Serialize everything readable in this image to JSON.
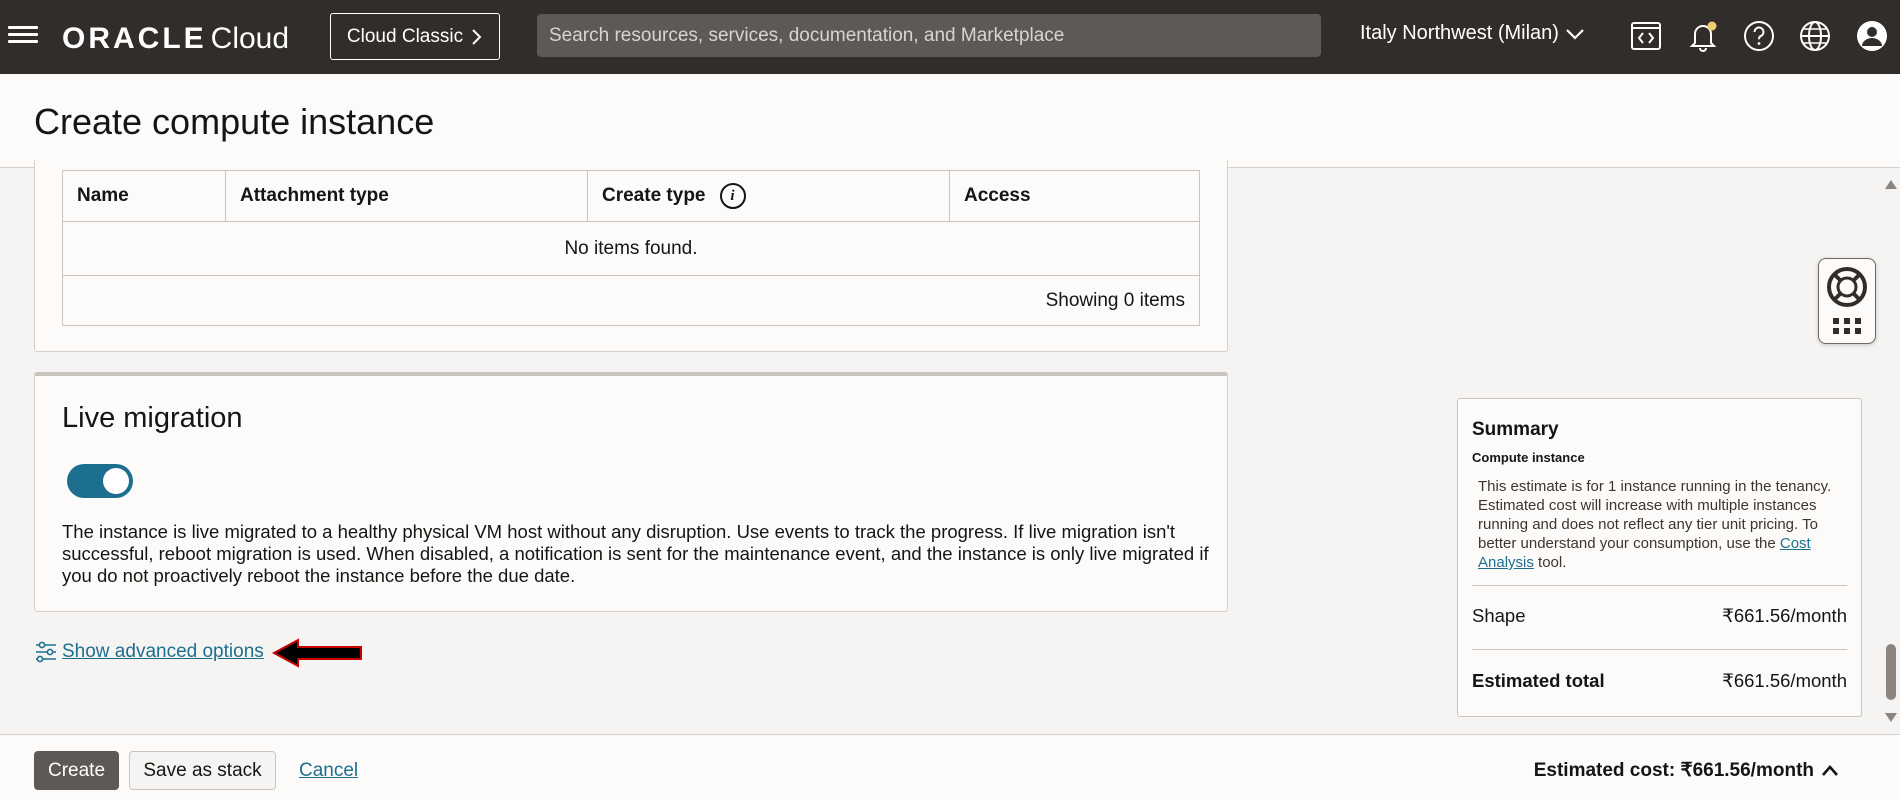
{
  "topbar": {
    "logo_brand": "ORACLE",
    "logo_product": "Cloud",
    "classic_button": "Cloud Classic",
    "search_placeholder": "Search resources, services, documentation, and Marketplace",
    "region": "Italy Northwest (Milan)"
  },
  "page": {
    "title": "Create compute instance"
  },
  "attachments_table": {
    "columns": [
      "Name",
      "Attachment type",
      "Create type",
      "Access"
    ],
    "empty_text": "No items found.",
    "footer_text": "Showing 0 items"
  },
  "live_migration": {
    "title": "Live migration",
    "enabled": true,
    "description": "The instance is live migrated to a healthy physical VM host without any disruption. Use events to track the progress. If live migration isn't successful, reboot migration is used. When disabled, a notification is sent for the maintenance event, and the instance is only live migrated if you do not proactively reboot the instance before the due date."
  },
  "advanced_link": "Show advanced options",
  "summary": {
    "title": "Summary",
    "subtitle": "Compute instance",
    "description_pre": "This estimate is for 1 instance running in the tenancy. Estimated cost will increase with multiple instances running and does not reflect any tier unit pricing. To better understand your consumption, use the ",
    "description_link": "Cost Analysis",
    "description_post": " tool.",
    "shape_label": "Shape",
    "shape_value": "₹661.56/month",
    "total_label": "Estimated total",
    "total_value": "₹661.56/month"
  },
  "footer": {
    "create": "Create",
    "save_stack": "Save as stack",
    "cancel": "Cancel",
    "estimated_cost": "Estimated cost: ₹661.56/month"
  },
  "colors": {
    "topbar": "#312d2a",
    "accent": "#1d6f8f",
    "primary_button": "#5e5955",
    "annotation_arrow": "#cc0000"
  }
}
